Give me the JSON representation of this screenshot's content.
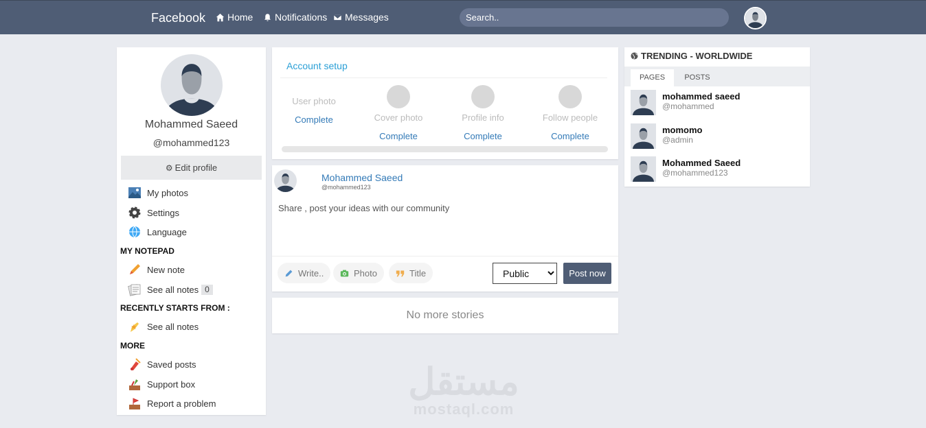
{
  "topbar": {
    "brand": "Facebook",
    "nav": [
      {
        "label": "Home",
        "icon": "home-icon"
      },
      {
        "label": "Notifications",
        "icon": "bell-icon"
      },
      {
        "label": "Messages",
        "icon": "envelope-icon"
      }
    ],
    "search_placeholder": "Search.."
  },
  "profile": {
    "name": "Mohammed Saeed",
    "handle": "@mohammed123",
    "edit_label": "Edit profile",
    "menu": [
      {
        "label": "My photos",
        "icon": "photos-icon"
      },
      {
        "label": "Settings",
        "icon": "gear-icon"
      },
      {
        "label": "Language",
        "icon": "globe-icon"
      }
    ],
    "notepad_title": "MY NOTEPAD",
    "notepad": [
      {
        "label": "New note",
        "icon": "pencil-icon"
      },
      {
        "label": "See all notes",
        "icon": "notes-icon",
        "count": "0"
      }
    ],
    "recent_title": "RECENTLY STARTS FROM :",
    "recent": [
      {
        "label": "See all notes",
        "icon": "star-note-icon"
      }
    ],
    "more_title": "MORE",
    "more": [
      {
        "label": "Saved posts",
        "icon": "bookmark-icon"
      },
      {
        "label": "Support box",
        "icon": "support-icon"
      },
      {
        "label": "Report a problem",
        "icon": "report-icon"
      }
    ]
  },
  "account_setup": {
    "title": "Account setup",
    "steps": [
      {
        "label": "User photo",
        "status": "Complete"
      },
      {
        "label": "Cover photo",
        "status": "Complete"
      },
      {
        "label": "Profile info",
        "status": "Complete"
      },
      {
        "label": "Follow people",
        "status": "Complete"
      }
    ]
  },
  "composer": {
    "name": "Mohammed Saeed",
    "handle": "@mohammed123",
    "placeholder": "Share , post your ideas with our community",
    "actions": [
      {
        "label": "Write..",
        "icon": "pencil-icon",
        "color": "#5b9bd5"
      },
      {
        "label": "Photo",
        "icon": "camera-icon",
        "color": "#5cb85c"
      },
      {
        "label": "Title",
        "icon": "quote-icon",
        "color": "#f0ad4e"
      }
    ],
    "privacy": "Public",
    "post_label": "Post now"
  },
  "feed": {
    "empty_text": "No more stories"
  },
  "trending": {
    "title": "TRENDING - WORLDWIDE",
    "tabs": [
      "PAGES",
      "POSTS"
    ],
    "items": [
      {
        "name": "mohammed saeed",
        "handle": "@mohammed"
      },
      {
        "name": "momomo",
        "handle": "@admin"
      },
      {
        "name": "Mohammed Saeed",
        "handle": "@mohammed123"
      }
    ]
  },
  "watermark": {
    "arabic": "مستقل",
    "latin": "mostaql.com"
  },
  "colors": {
    "topbar": "#4f5d75",
    "link": "#337ab7",
    "accent": "#2a9fd6",
    "background": "#e9ebf0"
  }
}
